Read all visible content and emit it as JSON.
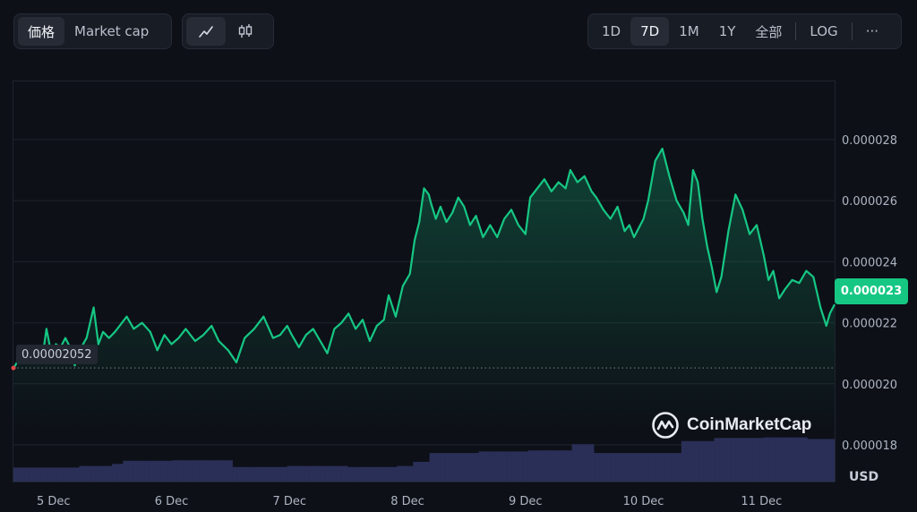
{
  "toolbar": {
    "metric_tabs": [
      {
        "label": "価格",
        "active": true
      },
      {
        "label": "Market cap",
        "active": false
      }
    ],
    "chart_type_icons": [
      "line-chart-icon",
      "candlestick-icon"
    ],
    "ranges": [
      {
        "label": "1D",
        "active": false
      },
      {
        "label": "7D",
        "active": true
      },
      {
        "label": "1M",
        "active": false
      },
      {
        "label": "1Y",
        "active": false
      },
      {
        "label": "全部",
        "active": false
      }
    ],
    "log_label": "LOG",
    "more_label": "···"
  },
  "brand": {
    "name": "CoinMarketCap"
  },
  "colors": {
    "line": "#16c784",
    "volume": "#2a2f57",
    "badge": "#16c784"
  },
  "chart_data": {
    "type": "line",
    "currency_label": "USD",
    "current_price_label": "0.000023",
    "open_price_label": "0.00002052",
    "open_price": 2.052e-05,
    "current_price": 2.3e-05,
    "ylim": [
      1.68e-05,
      2.99e-05
    ],
    "yticks": [
      {
        "value": 1.8e-05,
        "label": "0.000018"
      },
      {
        "value": 2e-05,
        "label": "0.000020"
      },
      {
        "value": 2.2e-05,
        "label": "0.000022"
      },
      {
        "value": 2.4e-05,
        "label": "0.000024"
      },
      {
        "value": 2.6e-05,
        "label": "0.000026"
      },
      {
        "value": 2.8e-05,
        "label": "0.000028"
      }
    ],
    "x_start": 4.66,
    "x_end": 11.62,
    "xticks": [
      {
        "value": 5,
        "label": "5 Dec"
      },
      {
        "value": 6,
        "label": "6 Dec"
      },
      {
        "value": 7,
        "label": "7 Dec"
      },
      {
        "value": 8,
        "label": "8 Dec"
      },
      {
        "value": 9,
        "label": "9 Dec"
      },
      {
        "value": 10,
        "label": "10 Dec"
      },
      {
        "value": 11,
        "label": "11 Dec"
      }
    ],
    "price_series": {
      "x": [
        4.66,
        4.72,
        4.78,
        4.84,
        4.9,
        4.94,
        4.98,
        5.02,
        5.06,
        5.1,
        5.14,
        5.18,
        5.22,
        5.28,
        5.34,
        5.38,
        5.42,
        5.47,
        5.52,
        5.56,
        5.62,
        5.68,
        5.75,
        5.82,
        5.88,
        5.94,
        6.0,
        6.06,
        6.12,
        6.2,
        6.27,
        6.34,
        6.4,
        6.48,
        6.55,
        6.62,
        6.7,
        6.78,
        6.86,
        6.92,
        6.98,
        7.02,
        7.08,
        7.14,
        7.2,
        7.26,
        7.32,
        7.38,
        7.44,
        7.5,
        7.56,
        7.62,
        7.68,
        7.74,
        7.8,
        7.84,
        7.9,
        7.96,
        8.02,
        8.06,
        8.1,
        8.14,
        8.18,
        8.2,
        8.24,
        8.28,
        8.33,
        8.38,
        8.43,
        8.48,
        8.53,
        8.58,
        8.64,
        8.7,
        8.76,
        8.82,
        8.88,
        8.94,
        9.0,
        9.04,
        9.1,
        9.16,
        9.22,
        9.28,
        9.34,
        9.38,
        9.44,
        9.5,
        9.56,
        9.6,
        9.66,
        9.72,
        9.78,
        9.84,
        9.88,
        9.92,
        9.96,
        10.0,
        10.04,
        10.1,
        10.16,
        10.22,
        10.28,
        10.34,
        10.38,
        10.42,
        10.46,
        10.5,
        10.54,
        10.58,
        10.62,
        10.66,
        10.72,
        10.78,
        10.84,
        10.9,
        10.96,
        11.02,
        11.06,
        11.1,
        11.15,
        11.2,
        11.26,
        11.32,
        11.38,
        11.44,
        11.5,
        11.55,
        11.58,
        11.62
      ],
      "values": [
        2.05e-05,
        2.09e-05,
        2.08e-05,
        2.1e-05,
        2.07e-05,
        2.18e-05,
        2.1e-05,
        2.13e-05,
        2.12e-05,
        2.15e-05,
        2.12e-05,
        2.06e-05,
        2.11e-05,
        2.15e-05,
        2.25e-05,
        2.13e-05,
        2.17e-05,
        2.15e-05,
        2.17e-05,
        2.19e-05,
        2.22e-05,
        2.18e-05,
        2.2e-05,
        2.17e-05,
        2.11e-05,
        2.16e-05,
        2.13e-05,
        2.15e-05,
        2.18e-05,
        2.14e-05,
        2.16e-05,
        2.19e-05,
        2.14e-05,
        2.11e-05,
        2.07e-05,
        2.15e-05,
        2.18e-05,
        2.22e-05,
        2.15e-05,
        2.16e-05,
        2.19e-05,
        2.16e-05,
        2.12e-05,
        2.16e-05,
        2.18e-05,
        2.14e-05,
        2.1e-05,
        2.18e-05,
        2.2e-05,
        2.23e-05,
        2.18e-05,
        2.21e-05,
        2.14e-05,
        2.19e-05,
        2.21e-05,
        2.29e-05,
        2.22e-05,
        2.32e-05,
        2.36e-05,
        2.47e-05,
        2.53e-05,
        2.64e-05,
        2.62e-05,
        2.59e-05,
        2.54e-05,
        2.58e-05,
        2.53e-05,
        2.56e-05,
        2.61e-05,
        2.58e-05,
        2.52e-05,
        2.55e-05,
        2.48e-05,
        2.52e-05,
        2.48e-05,
        2.54e-05,
        2.57e-05,
        2.52e-05,
        2.49e-05,
        2.61e-05,
        2.64e-05,
        2.67e-05,
        2.63e-05,
        2.66e-05,
        2.64e-05,
        2.7e-05,
        2.66e-05,
        2.68e-05,
        2.63e-05,
        2.61e-05,
        2.57e-05,
        2.54e-05,
        2.58e-05,
        2.5e-05,
        2.52e-05,
        2.48e-05,
        2.51e-05,
        2.54e-05,
        2.6e-05,
        2.73e-05,
        2.77e-05,
        2.68e-05,
        2.6e-05,
        2.56e-05,
        2.52e-05,
        2.7e-05,
        2.66e-05,
        2.54e-05,
        2.45e-05,
        2.38e-05,
        2.3e-05,
        2.35e-05,
        2.5e-05,
        2.62e-05,
        2.57e-05,
        2.49e-05,
        2.52e-05,
        2.42e-05,
        2.34e-05,
        2.37e-05,
        2.28e-05,
        2.31e-05,
        2.34e-05,
        2.33e-05,
        2.37e-05,
        2.35e-05,
        2.25e-05,
        2.19e-05,
        2.23e-05,
        2.26e-05
      ]
    },
    "volume_series": {
      "x": [
        4.66,
        5.0,
        5.2,
        5.5,
        5.6,
        6.0,
        6.5,
        7.0,
        7.5,
        7.9,
        8.05,
        8.2,
        8.6,
        9.0,
        9.4,
        9.6,
        10.0,
        10.3,
        10.6,
        11.0,
        11.4,
        11.62
      ],
      "values": [
        0.27,
        0.27,
        0.3,
        0.34,
        0.4,
        0.41,
        0.28,
        0.3,
        0.28,
        0.3,
        0.38,
        0.55,
        0.58,
        0.6,
        0.72,
        0.55,
        0.55,
        0.78,
        0.84,
        0.85,
        0.82,
        0.7
      ]
    }
  }
}
